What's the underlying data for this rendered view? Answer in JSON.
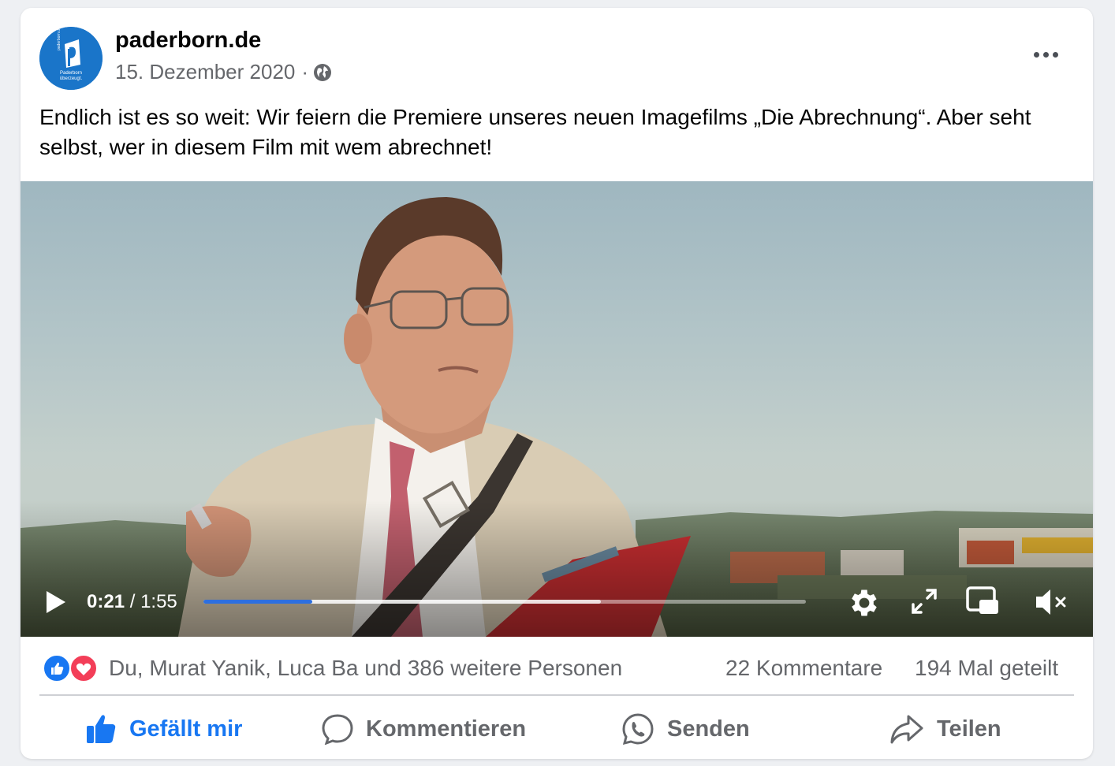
{
  "post": {
    "page_name": "paderborn.de",
    "date": "15. Dezember 2020",
    "separator": "·",
    "visibility_icon": "globe-icon",
    "text": "Endlich ist es so weit: Wir feiern die Premiere unseres neuen Imagefilms „Die Abrechnung“. Aber seht selbst, wer in diesem Film mit wem abrechnet!"
  },
  "avatar": {
    "vertical_text": "paderborn.de",
    "text_line1": "Paderborn",
    "text_line2": "überzeugt."
  },
  "video": {
    "current_time": "0:21",
    "time_separator": " / ",
    "duration": "1:55",
    "progress_fraction": 0.18,
    "buffered_fraction": 0.66,
    "controls": [
      "play-icon",
      "gear-icon",
      "fullscreen-icon",
      "picture-in-picture-icon",
      "muted-speaker-icon"
    ]
  },
  "stats": {
    "reactions_text": "Du, Murat Yanik, Luca Ba und 386 weitere Personen",
    "comments": "22 Kommentare",
    "shares": "194 Mal geteilt"
  },
  "actions": {
    "like": "Gefällt mir",
    "comment": "Kommentieren",
    "send": "Senden",
    "share": "Teilen"
  },
  "colors": {
    "accent": "#1877f2",
    "secondary_text": "#65676b",
    "progress": "#2d6fe0",
    "avatar_bg": "#1a75c9",
    "love": "#f33e58"
  }
}
